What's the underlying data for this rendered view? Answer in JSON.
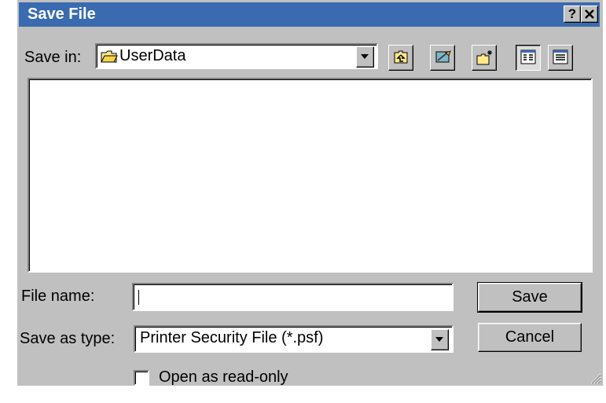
{
  "window": {
    "title": "Save File",
    "help_button": "?",
    "close_button": "✕"
  },
  "save_in": {
    "label": "Save in:",
    "value": "UserData",
    "icon": "folder-icon"
  },
  "toolbar": {
    "buttons": [
      {
        "name": "up-one-level",
        "icon": "folder-up-icon"
      },
      {
        "name": "desktop",
        "icon": "desktop-icon"
      },
      {
        "name": "create-new-folder",
        "icon": "new-folder-icon"
      },
      {
        "name": "list-view",
        "icon": "list-view-icon",
        "pressed": true
      },
      {
        "name": "details-view",
        "icon": "details-view-icon",
        "pressed": false
      }
    ]
  },
  "file_list": {
    "items": []
  },
  "file_name": {
    "label": "File name:",
    "value": ""
  },
  "save_as_type": {
    "label": "Save as type:",
    "value": "Printer Security File (*.psf)"
  },
  "buttons": {
    "save": "Save",
    "cancel": "Cancel"
  },
  "read_only": {
    "label": "Open as read-only",
    "checked": false
  },
  "colors": {
    "titlebar": "#3a6bb0",
    "face": "#c0c0c0",
    "window": "#ffffff"
  }
}
